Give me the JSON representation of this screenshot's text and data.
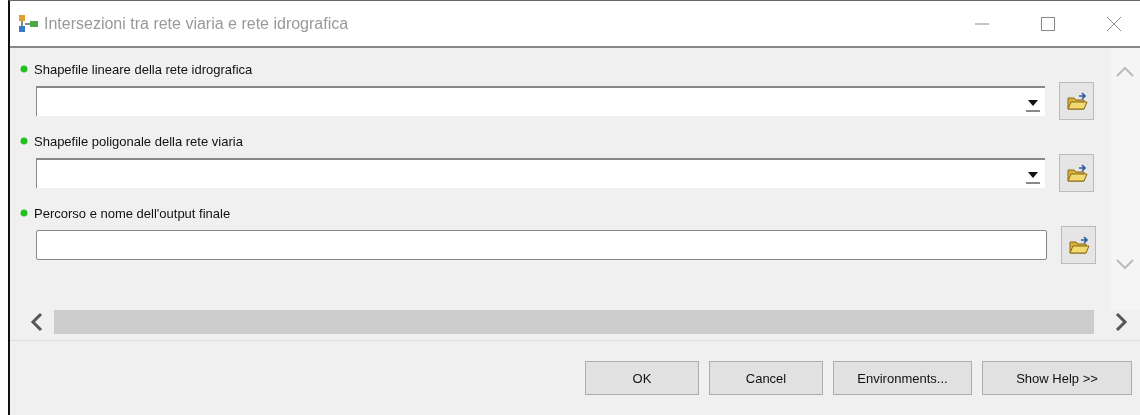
{
  "window": {
    "title": "Intersezioni tra rete viaria e rete idrografica"
  },
  "parameters": [
    {
      "label": "Shapefile lineare della rete idrografica",
      "kind": "combo",
      "required": true
    },
    {
      "label": "Shapefile poligonale della rete viaria",
      "kind": "combo",
      "required": true
    },
    {
      "label": "Percorso e nome dell'output finale",
      "kind": "text",
      "required": true
    }
  ],
  "buttons": [
    "OK",
    "Cancel",
    "Environments...",
    "Show Help >>"
  ]
}
